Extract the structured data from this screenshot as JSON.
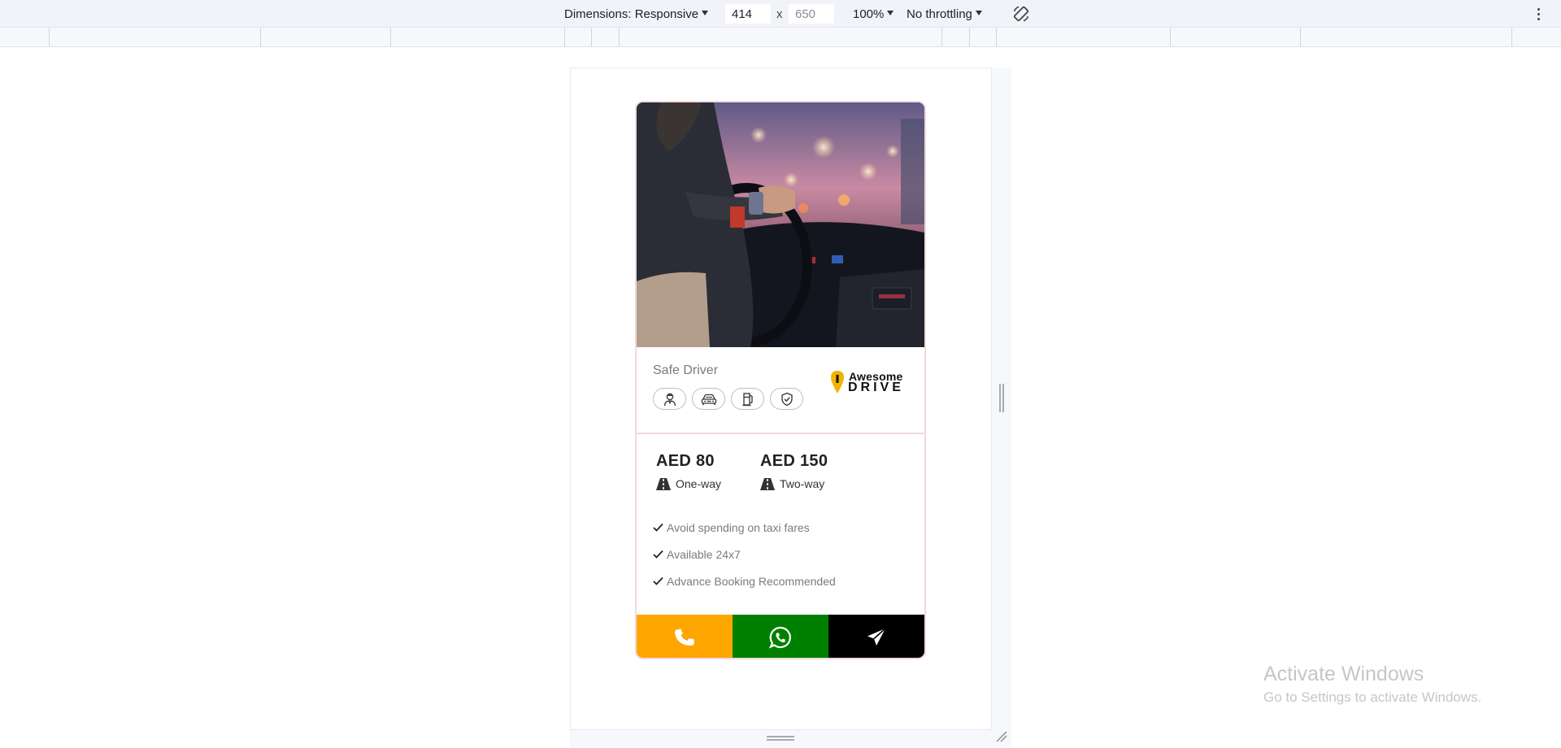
{
  "devtools": {
    "dimensions_label": "Dimensions: Responsive",
    "width_value": "414",
    "height_value": "650",
    "times": "x",
    "zoom": "100%",
    "throttling": "No throttling"
  },
  "card": {
    "title": "Safe Driver",
    "features": [
      "driver-icon",
      "car-icon",
      "fuel-pump-icon",
      "shield-check-icon"
    ],
    "logo_line1": "Awesome",
    "logo_line2": "DRIVE",
    "prices": [
      {
        "value": "AED 80",
        "label": "One-way"
      },
      {
        "value": "AED 150",
        "label": "Two-way"
      }
    ],
    "benefits": [
      "Avoid spending on taxi fares",
      "Available 24x7",
      "Advance Booking Recommended"
    ],
    "actions": [
      {
        "name": "call",
        "icon": "phone-icon",
        "color": "#ffa500"
      },
      {
        "name": "whatsapp",
        "icon": "whatsapp-icon",
        "color": "#008000"
      },
      {
        "name": "send",
        "icon": "send-icon",
        "color": "#000000"
      }
    ],
    "logo_color": "#f0b400"
  },
  "watermark": {
    "title": "Activate Windows",
    "subtitle": "Go to Settings to activate Windows."
  }
}
